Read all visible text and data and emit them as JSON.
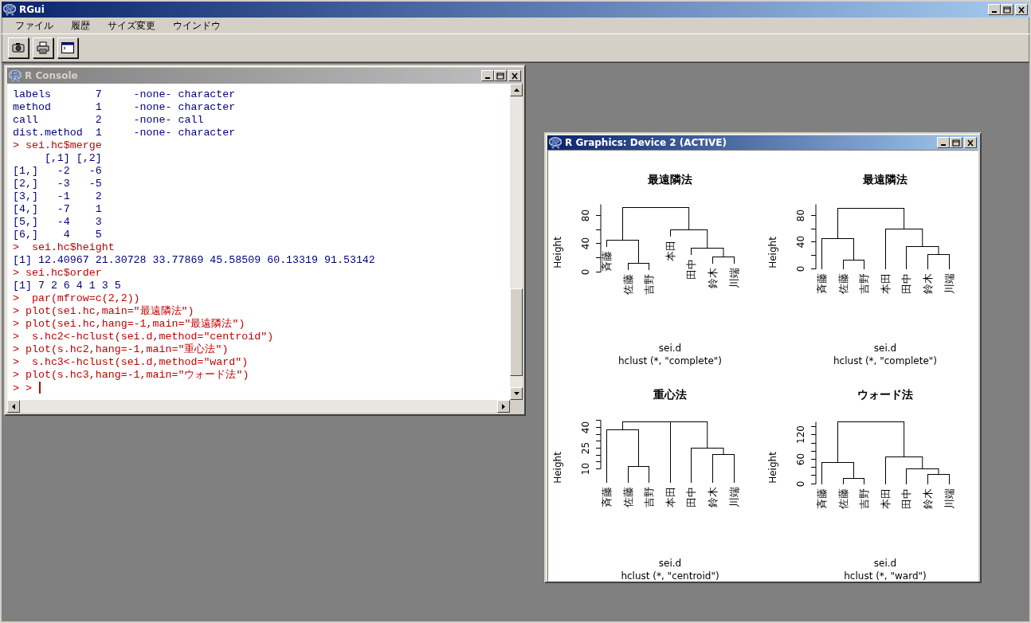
{
  "app": {
    "title": "RGui"
  },
  "menu": [
    {
      "label": "ファイル"
    },
    {
      "label": "履歴"
    },
    {
      "label": "サイズ変更"
    },
    {
      "label": "ウインドウ"
    }
  ],
  "console": {
    "title": "R Console",
    "active": false,
    "lines": [
      {
        "kind": "output",
        "text": "labels       7     -none- character"
      },
      {
        "kind": "output",
        "text": "method       1     -none- character"
      },
      {
        "kind": "output",
        "text": "call         2     -none- call"
      },
      {
        "kind": "output",
        "text": "dist.method  1     -none- character"
      },
      {
        "kind": "input",
        "text": "> sei.hc$merge"
      },
      {
        "kind": "output",
        "text": "     [,1] [,2]"
      },
      {
        "kind": "output",
        "text": "[1,]   -2   -6"
      },
      {
        "kind": "output",
        "text": "[2,]   -3   -5"
      },
      {
        "kind": "output",
        "text": "[3,]   -1    2"
      },
      {
        "kind": "output",
        "text": "[4,]   -7    1"
      },
      {
        "kind": "output",
        "text": "[5,]   -4    3"
      },
      {
        "kind": "output",
        "text": "[6,]    4    5"
      },
      {
        "kind": "input",
        "text": ">  sei.hc$height"
      },
      {
        "kind": "output",
        "text": "[1] 12.40967 21.30728 33.77869 45.58509 60.13319 91.53142"
      },
      {
        "kind": "input",
        "text": "> sei.hc$order"
      },
      {
        "kind": "output",
        "text": "[1] 7 2 6 4 1 3 5"
      },
      {
        "kind": "input",
        "text": ">  par(mfrow=c(2,2))"
      },
      {
        "kind": "input",
        "text": "> plot(sei.hc,main=\"最遠隣法\")"
      },
      {
        "kind": "input",
        "text": "> plot(sei.hc,hang=-1,main=\"最遠隣法\")"
      },
      {
        "kind": "input",
        "text": ">  s.hc2<-hclust(sei.d,method=\"centroid\")"
      },
      {
        "kind": "input",
        "text": "> plot(s.hc2,hang=-1,main=\"重心法\")"
      },
      {
        "kind": "input",
        "text": ">  s.hc3<-hclust(sei.d,method=\"ward\")"
      },
      {
        "kind": "input",
        "text": "> plot(s.hc3,hang=-1,main=\"ウォード法\")"
      }
    ],
    "prompt": "> > "
  },
  "graphics": {
    "title": "R Graphics: Device 2 (ACTIVE)",
    "active": true,
    "plots": [
      {
        "title": "最遠隣法",
        "ylabel": "Height",
        "yticks": [
          "0",
          "40",
          "80"
        ],
        "leaves": [
          "斉藤",
          "佐藤",
          "吉野",
          "本田",
          "田中",
          "鈴木",
          "川端"
        ],
        "xlabel": "sei.d",
        "sub": "hclust (*, \"complete\")"
      },
      {
        "title": "最遠隣法",
        "ylabel": "Height",
        "yticks": [
          "0",
          "40",
          "80"
        ],
        "leaves": [
          "斉藤",
          "佐藤",
          "吉野",
          "本田",
          "田中",
          "鈴木",
          "川端"
        ],
        "xlabel": "sei.d",
        "sub": "hclust (*, \"complete\")"
      },
      {
        "title": "重心法",
        "ylabel": "Height",
        "yticks": [
          "10",
          "25",
          "40"
        ],
        "leaves": [
          "斉藤",
          "佐藤",
          "吉野",
          "本田",
          "田中",
          "鈴木",
          "川端"
        ],
        "xlabel": "sei.d",
        "sub": "hclust (*, \"centroid\")"
      },
      {
        "title": "ウォード法",
        "ylabel": "Height",
        "yticks": [
          "0",
          "60",
          "120"
        ],
        "leaves": [
          "斉藤",
          "佐藤",
          "吉野",
          "本田",
          "田中",
          "鈴木",
          "川端"
        ],
        "xlabel": "sei.d",
        "sub": "hclust (*, \"ward\")"
      }
    ]
  }
}
